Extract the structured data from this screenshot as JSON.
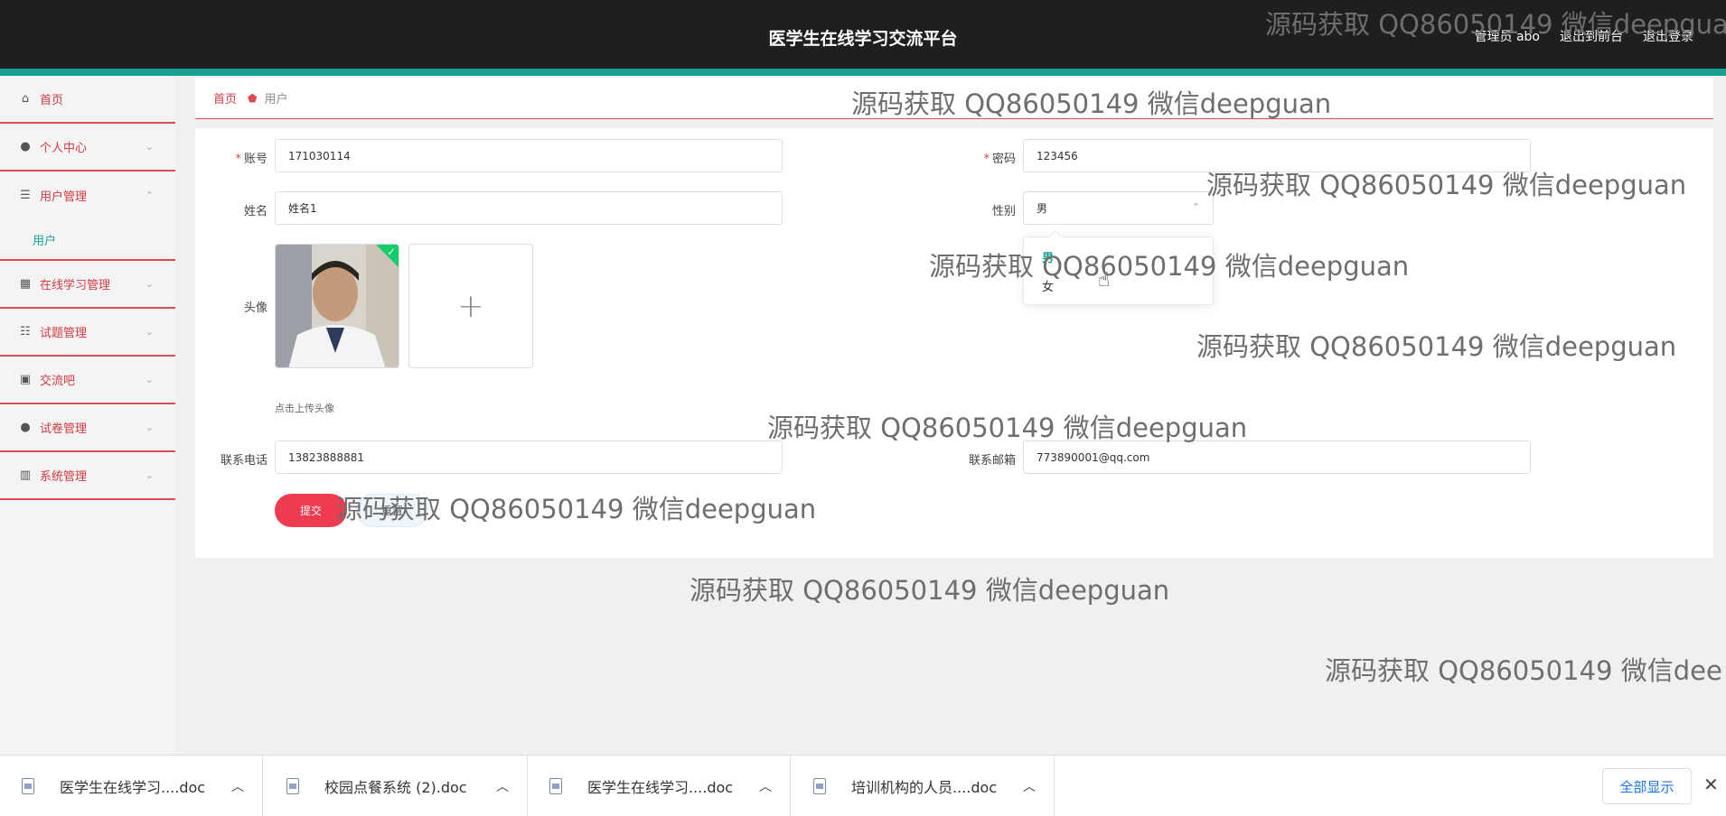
{
  "header": {
    "title": "医学生在线学习交流平台",
    "user_label": "管理员 abo",
    "to_front": "退出到前台",
    "logout": "退出登录"
  },
  "sidebar": {
    "items": [
      {
        "label": "首页",
        "icon": "home-icon"
      },
      {
        "label": "个人中心",
        "icon": "person-icon"
      },
      {
        "label": "用户管理",
        "icon": "list-icon"
      },
      {
        "label": "用户",
        "icon": ""
      },
      {
        "label": "在线学习管理",
        "icon": "grid-icon"
      },
      {
        "label": "试题管理",
        "icon": "sliders-icon"
      },
      {
        "label": "交流吧",
        "icon": "clipboard-icon"
      },
      {
        "label": "试卷管理",
        "icon": "person-icon"
      },
      {
        "label": "系统管理",
        "icon": "bank-icon"
      }
    ]
  },
  "breadcrumb": {
    "home": "首页",
    "current": "用户"
  },
  "form": {
    "account_label": "账号",
    "account_value": "171030114",
    "password_label": "密码",
    "password_value": "123456",
    "name_label": "姓名",
    "name_value": "姓名1",
    "gender_label": "性别",
    "gender_value": "男",
    "avatar_label": "头像",
    "upload_plus": "+",
    "upload_tip": "点击上传头像",
    "phone_label": "联系电话",
    "phone_value": "13823888881",
    "email_label": "联系邮箱",
    "email_value": "773890001@qq.com",
    "submit_label": "提交",
    "reset_label": "重置"
  },
  "gender_dropdown": {
    "options": [
      "男",
      "女"
    ],
    "selected": "男"
  },
  "watermark": {
    "text": "源码获取 QQ86050149 微信deepguan",
    "text_cut_1": "源码获取 QQ86050149 微信deepgua",
    "text_cut_2": "源码获取 QQ86050149 微信dee"
  },
  "downloads": {
    "items": [
      "医学生在线学习....doc",
      "校园点餐系统 (2).doc",
      "医学生在线学习....doc",
      "培训机构的人员....doc"
    ],
    "show_all": "全部显示",
    "close": "✕"
  },
  "colors": {
    "header_bg": "#1f1f1f",
    "accent_teal": "#17a195",
    "accent_red": "#e0494f",
    "submit_red": "#ee3b4f"
  }
}
